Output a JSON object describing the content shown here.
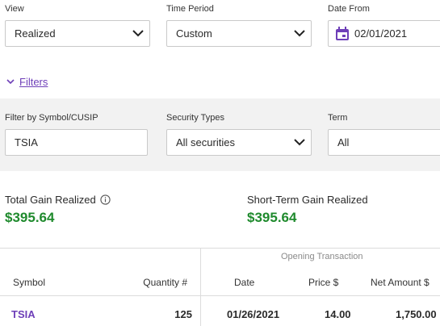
{
  "view": {
    "label": "View",
    "value": "Realized"
  },
  "time_period": {
    "label": "Time Period",
    "value": "Custom"
  },
  "date_from": {
    "label": "Date From",
    "value": "02/01/2021"
  },
  "filters_toggle": {
    "label": "Filters"
  },
  "filter_symbol": {
    "label": "Filter by Symbol/CUSIP",
    "value": "TSIA"
  },
  "security_types": {
    "label": "Security Types",
    "value": "All securities"
  },
  "term": {
    "label": "Term",
    "value": "All"
  },
  "summary": {
    "total_label": "Total Gain Realized",
    "total_value": "$395.64",
    "short_label": "Short-Term Gain Realized",
    "short_value": "$395.64"
  },
  "table": {
    "group_header": "Opening Transaction",
    "columns": {
      "symbol": "Symbol",
      "quantity": "Quantity #",
      "date": "Date",
      "price": "Price $",
      "net_amount": "Net Amount $"
    },
    "rows": [
      {
        "symbol": "TSIA",
        "quantity": "125",
        "date": "01/26/2021",
        "price": "14.00",
        "net_amount": "1,750.00"
      }
    ]
  },
  "colors": {
    "accent": "#6e3fb8",
    "gain": "#1f8a2d"
  },
  "icons": {
    "dropdown": "chevron-down-icon",
    "calendar": "calendar-icon",
    "filters": "chevron-down-icon",
    "info": "info-icon"
  }
}
